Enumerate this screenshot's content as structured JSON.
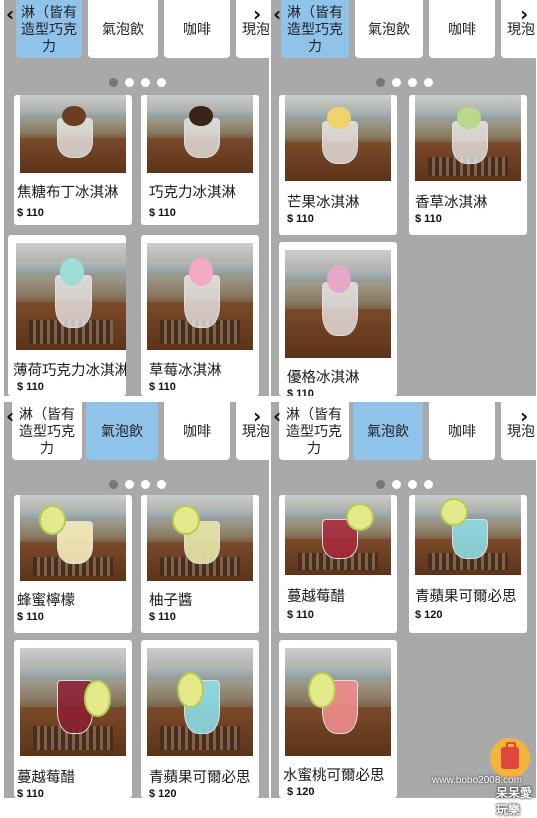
{
  "tabs": {
    "dessert_partial": "淋（皆有造型巧克力",
    "soda": "氣泡飲",
    "coffee": "咖啡",
    "present": "現泡",
    "present_partial": "現泡"
  },
  "panels": [
    {
      "id": "top-left",
      "active_tab": "dessert",
      "items": [
        {
          "name": "焦糖布丁冰淇淋",
          "price": "$ 110",
          "photo": "ice-cream-caramel"
        },
        {
          "name": "巧克力冰淇淋",
          "price": "$ 110",
          "photo": "ice-cream-chocolate"
        },
        {
          "name": "薄荷巧克力冰淇淋",
          "price": "$ 110",
          "photo": "ice-cream-mint"
        },
        {
          "name": "草莓冰淇淋",
          "price": "$ 110",
          "photo": "ice-cream-strawberry"
        }
      ]
    },
    {
      "id": "top-right",
      "active_tab": "dessert",
      "items": [
        {
          "name": "芒果冰淇淋",
          "price": "$ 110",
          "photo": "ice-cream-mango"
        },
        {
          "name": "香草冰淇淋",
          "price": "$ 110",
          "photo": "ice-cream-vanilla"
        },
        {
          "name": "優格冰淇淋",
          "price": "$ 110",
          "photo": "ice-cream-yogurt"
        }
      ]
    },
    {
      "id": "bottom-left",
      "active_tab": "soda",
      "items": [
        {
          "name": "蜂蜜檸檬",
          "price": "$ 110",
          "photo": "drink-honey-lemon"
        },
        {
          "name": "柚子醬",
          "price": "$ 110",
          "photo": "drink-yuzu"
        },
        {
          "name": "蔓越莓醋",
          "price": "$ 110",
          "photo": "drink-cranberry"
        },
        {
          "name": "青蘋果可爾必思",
          "price": "$ 120",
          "photo": "drink-green-apple"
        }
      ]
    },
    {
      "id": "bottom-right",
      "active_tab": "soda",
      "items": [
        {
          "name": "蔓越莓醋",
          "price": "$ 110",
          "photo": "drink-cranberry"
        },
        {
          "name": "青蘋果可爾必思",
          "price": "$ 120",
          "photo": "drink-green-apple"
        },
        {
          "name": "水蜜桃可爾必思",
          "price": "$ 120",
          "photo": "drink-peach"
        }
      ]
    }
  ],
  "icons": {
    "prev": "chevron-left-icon",
    "next": "chevron-right-icon",
    "badge": "suitcase-icon"
  },
  "colors": {
    "active_tab": "#8fc3ea",
    "panel_bg": "#a9a9a9",
    "badge": "#f4b43a"
  },
  "pager": {
    "count": 4,
    "current": 1
  },
  "watermark": {
    "url": "www.bobo2008.com",
    "brand": "呆呆愛玩樂"
  }
}
